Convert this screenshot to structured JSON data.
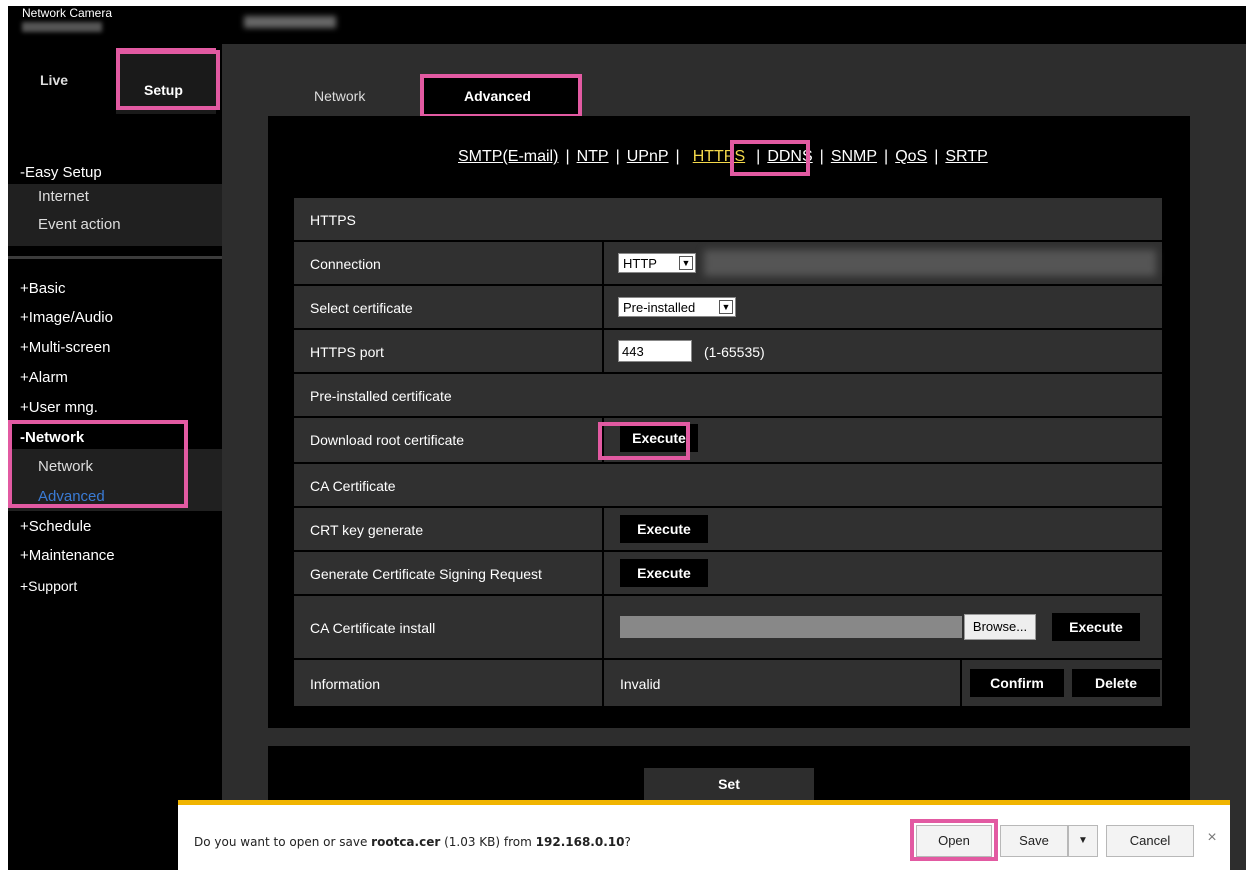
{
  "window": {
    "brand": "Network Camera"
  },
  "sidebar": {
    "tab_live": "Live",
    "tab_setup": "Setup",
    "easy_setup": "-Easy Setup",
    "easy_items": [
      "Internet",
      "Event action"
    ],
    "groups": [
      "+Basic",
      "+Image/Audio",
      "+Multi-screen",
      "+Alarm",
      "+User mng."
    ],
    "network": "-Network",
    "network_items": [
      "Network",
      "Advanced"
    ],
    "groups2": [
      "+Schedule",
      "+Maintenance",
      "+Support"
    ]
  },
  "page_tabs": {
    "network": "Network",
    "advanced": "Advanced"
  },
  "links": [
    "SMTP(E-mail)",
    "NTP",
    "UPnP",
    "HTTPS",
    "DDNS",
    "SNMP",
    "QoS",
    "SRTP"
  ],
  "https": {
    "section": "HTTPS",
    "connection_label": "Connection",
    "connection_value": "HTTP",
    "select_cert_label": "Select certificate",
    "select_cert_value": "Pre-installed",
    "port_label": "HTTPS port",
    "port_value": "443",
    "port_range": "(1-65535)",
    "preinstalled_section": "Pre-installed certificate",
    "download_label": "Download root certificate",
    "ca_section": "CA Certificate",
    "crt_label": "CRT key generate",
    "csr_label": "Generate Certificate Signing Request",
    "ca_install_label": "CA Certificate install",
    "info_label": "Information",
    "info_value": "Invalid",
    "execute": "Execute",
    "browse": "Browse...",
    "confirm": "Confirm",
    "delete": "Delete"
  },
  "set_label": "Set",
  "download_bar": {
    "prefix": "Do you want to open or save ",
    "file": "rootca.cer",
    "size": " (1.03 KB) from ",
    "host": "192.168.0.10",
    "suffix": "?",
    "open": "Open",
    "save": "Save",
    "cancel": "Cancel",
    "close": "×"
  },
  "colors": {
    "highlight": "#e25aa2",
    "active_link": "#f4d94b",
    "warning_bar": "#f0b400"
  }
}
